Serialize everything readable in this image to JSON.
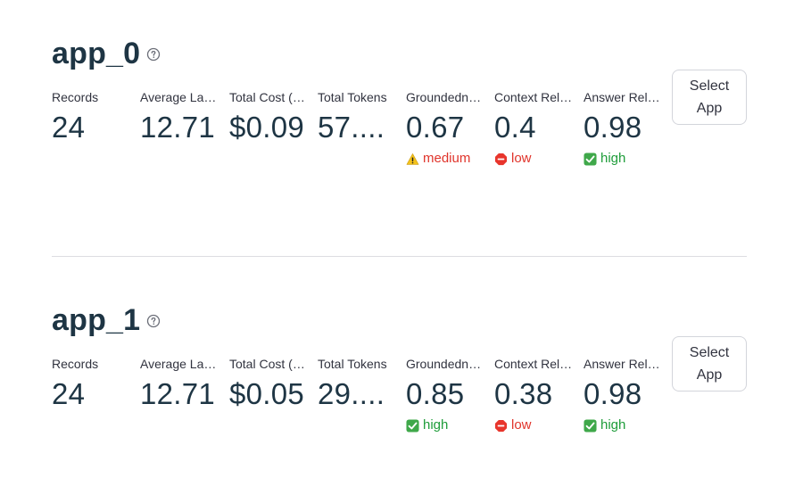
{
  "apps": [
    {
      "title": "app_0",
      "help_icon": "question-circle-icon",
      "select_button": "Select App",
      "metrics": [
        {
          "label": "Records",
          "value": "24"
        },
        {
          "label": "Average Latency",
          "value": "12.71"
        },
        {
          "label": "Total Cost (USD)",
          "value": "$0.09"
        },
        {
          "label": "Total Tokens",
          "value": "57...."
        },
        {
          "label": "Groundedness",
          "value": "0.67",
          "delta": {
            "text": "medium",
            "level": "medium",
            "icon": "warning-icon"
          }
        },
        {
          "label": "Context Relevance",
          "value": "0.4",
          "delta": {
            "text": "low",
            "level": "low",
            "icon": "stop-icon"
          }
        },
        {
          "label": "Answer Relevance",
          "value": "0.98",
          "delta": {
            "text": "high",
            "level": "high",
            "icon": "check-icon"
          }
        }
      ]
    },
    {
      "title": "app_1",
      "help_icon": "question-circle-icon",
      "select_button": "Select App",
      "metrics": [
        {
          "label": "Records",
          "value": "24"
        },
        {
          "label": "Average Latency",
          "value": "12.71"
        },
        {
          "label": "Total Cost (USD)",
          "value": "$0.05"
        },
        {
          "label": "Total Tokens",
          "value": "29...."
        },
        {
          "label": "Groundedness",
          "value": "0.85",
          "delta": {
            "text": "high",
            "level": "high",
            "icon": "check-icon"
          }
        },
        {
          "label": "Context Relevance",
          "value": "0.38",
          "delta": {
            "text": "low",
            "level": "low",
            "icon": "stop-icon"
          }
        },
        {
          "label": "Answer Relevance",
          "value": "0.98",
          "delta": {
            "text": "high",
            "level": "high",
            "icon": "check-icon"
          }
        }
      ]
    }
  ],
  "colors": {
    "title": "#1e3544",
    "low": "#e0342b",
    "medium": "#e0342b",
    "high": "#1e9c3a"
  }
}
